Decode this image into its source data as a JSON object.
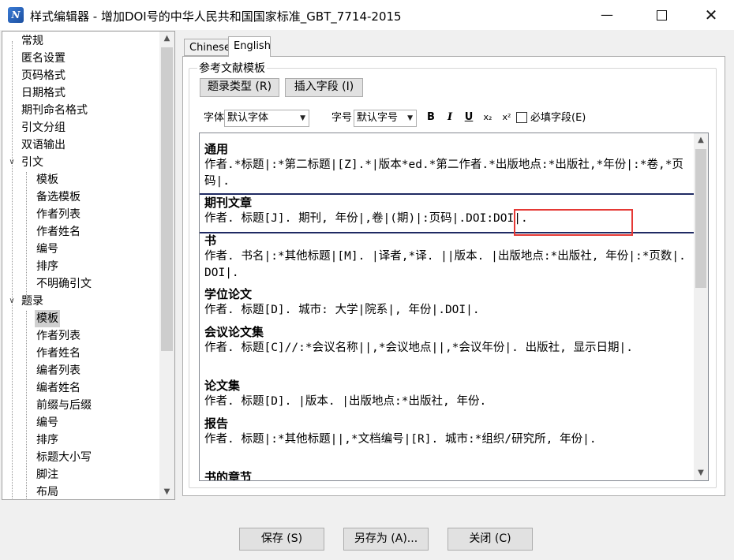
{
  "window": {
    "title": "样式编辑器 - 增加DOI号的中华人民共和国国家标准_GBT_7714-2015",
    "app_icon": "N",
    "minimize_glyph": "—",
    "close_glyph": "✕"
  },
  "tree": {
    "expanded_glyph": "∨",
    "items": [
      {
        "label": "常规"
      },
      {
        "label": "匿名设置"
      },
      {
        "label": "页码格式"
      },
      {
        "label": "日期格式"
      },
      {
        "label": "期刊命名格式"
      },
      {
        "label": "引文分组"
      },
      {
        "label": "双语输出"
      },
      {
        "label": "引文"
      },
      {
        "label": "模板"
      },
      {
        "label": "备选模板"
      },
      {
        "label": "作者列表"
      },
      {
        "label": "作者姓名"
      },
      {
        "label": "编号"
      },
      {
        "label": "排序"
      },
      {
        "label": "不明确引文"
      },
      {
        "label": "题录"
      },
      {
        "label": "模板"
      },
      {
        "label": "作者列表"
      },
      {
        "label": "作者姓名"
      },
      {
        "label": "编者列表"
      },
      {
        "label": "编者姓名"
      },
      {
        "label": "前缀与后缀"
      },
      {
        "label": "编号"
      },
      {
        "label": "排序"
      },
      {
        "label": "标题大小写"
      },
      {
        "label": "脚注"
      },
      {
        "label": "布局"
      }
    ]
  },
  "tabs": [
    {
      "label": "Chinese"
    },
    {
      "label": "English"
    }
  ],
  "group": {
    "label": "参考文献模板",
    "btn_type": "题录类型 (R)",
    "btn_insert": "插入字段 (I)"
  },
  "format": {
    "font_label": "字体",
    "font_value": "默认字体",
    "size_label": "字号",
    "size_value": "默认字号",
    "bold": "B",
    "italic": "I",
    "underline": "U",
    "subscript": "x₂",
    "superscript": "x²",
    "required_label": "必填字段(E)"
  },
  "editor": {
    "blocks": [
      {
        "head": "通用",
        "body": "作者.*标题|:*第二标题|[Z].*|版本*ed.*第二作者.*出版地点:*出版社,*年份|:*卷,*页码|."
      },
      {
        "head": "期刊文章",
        "body": "作者. 标题[J]. 期刊, 年份|,卷|(期)|:页码|.DOI:DOI|."
      },
      {
        "head": "书",
        "body": "作者. 书名|:*其他标题|[M]. |译者,*译. ||版本. |出版地点:*出版社, 年份|:*页数|.DOI|."
      },
      {
        "head": "学位论文",
        "body": "作者. 标题[D]. 城市: 大学|院系|, 年份|.DOI|."
      },
      {
        "head": "会议论文集",
        "body": "作者. 标题[C]//:*会议名称||,*会议地点||,*会议年份|. 出版社, 显示日期|."
      },
      {
        "head": "论文集",
        "body": "作者. 标题[D]. |版本. |出版地点:*出版社, 年份."
      },
      {
        "head": "报告",
        "body": "作者. 标题|:*其他标题||,*文档编号|[R]. 城市:*组织/研究所, 年份|."
      },
      {
        "head": "书的章节",
        "body": ""
      }
    ]
  },
  "buttons": {
    "save": "保存 (S)",
    "save_as": "另存为 (A)...",
    "close": "关闭 (C)"
  }
}
